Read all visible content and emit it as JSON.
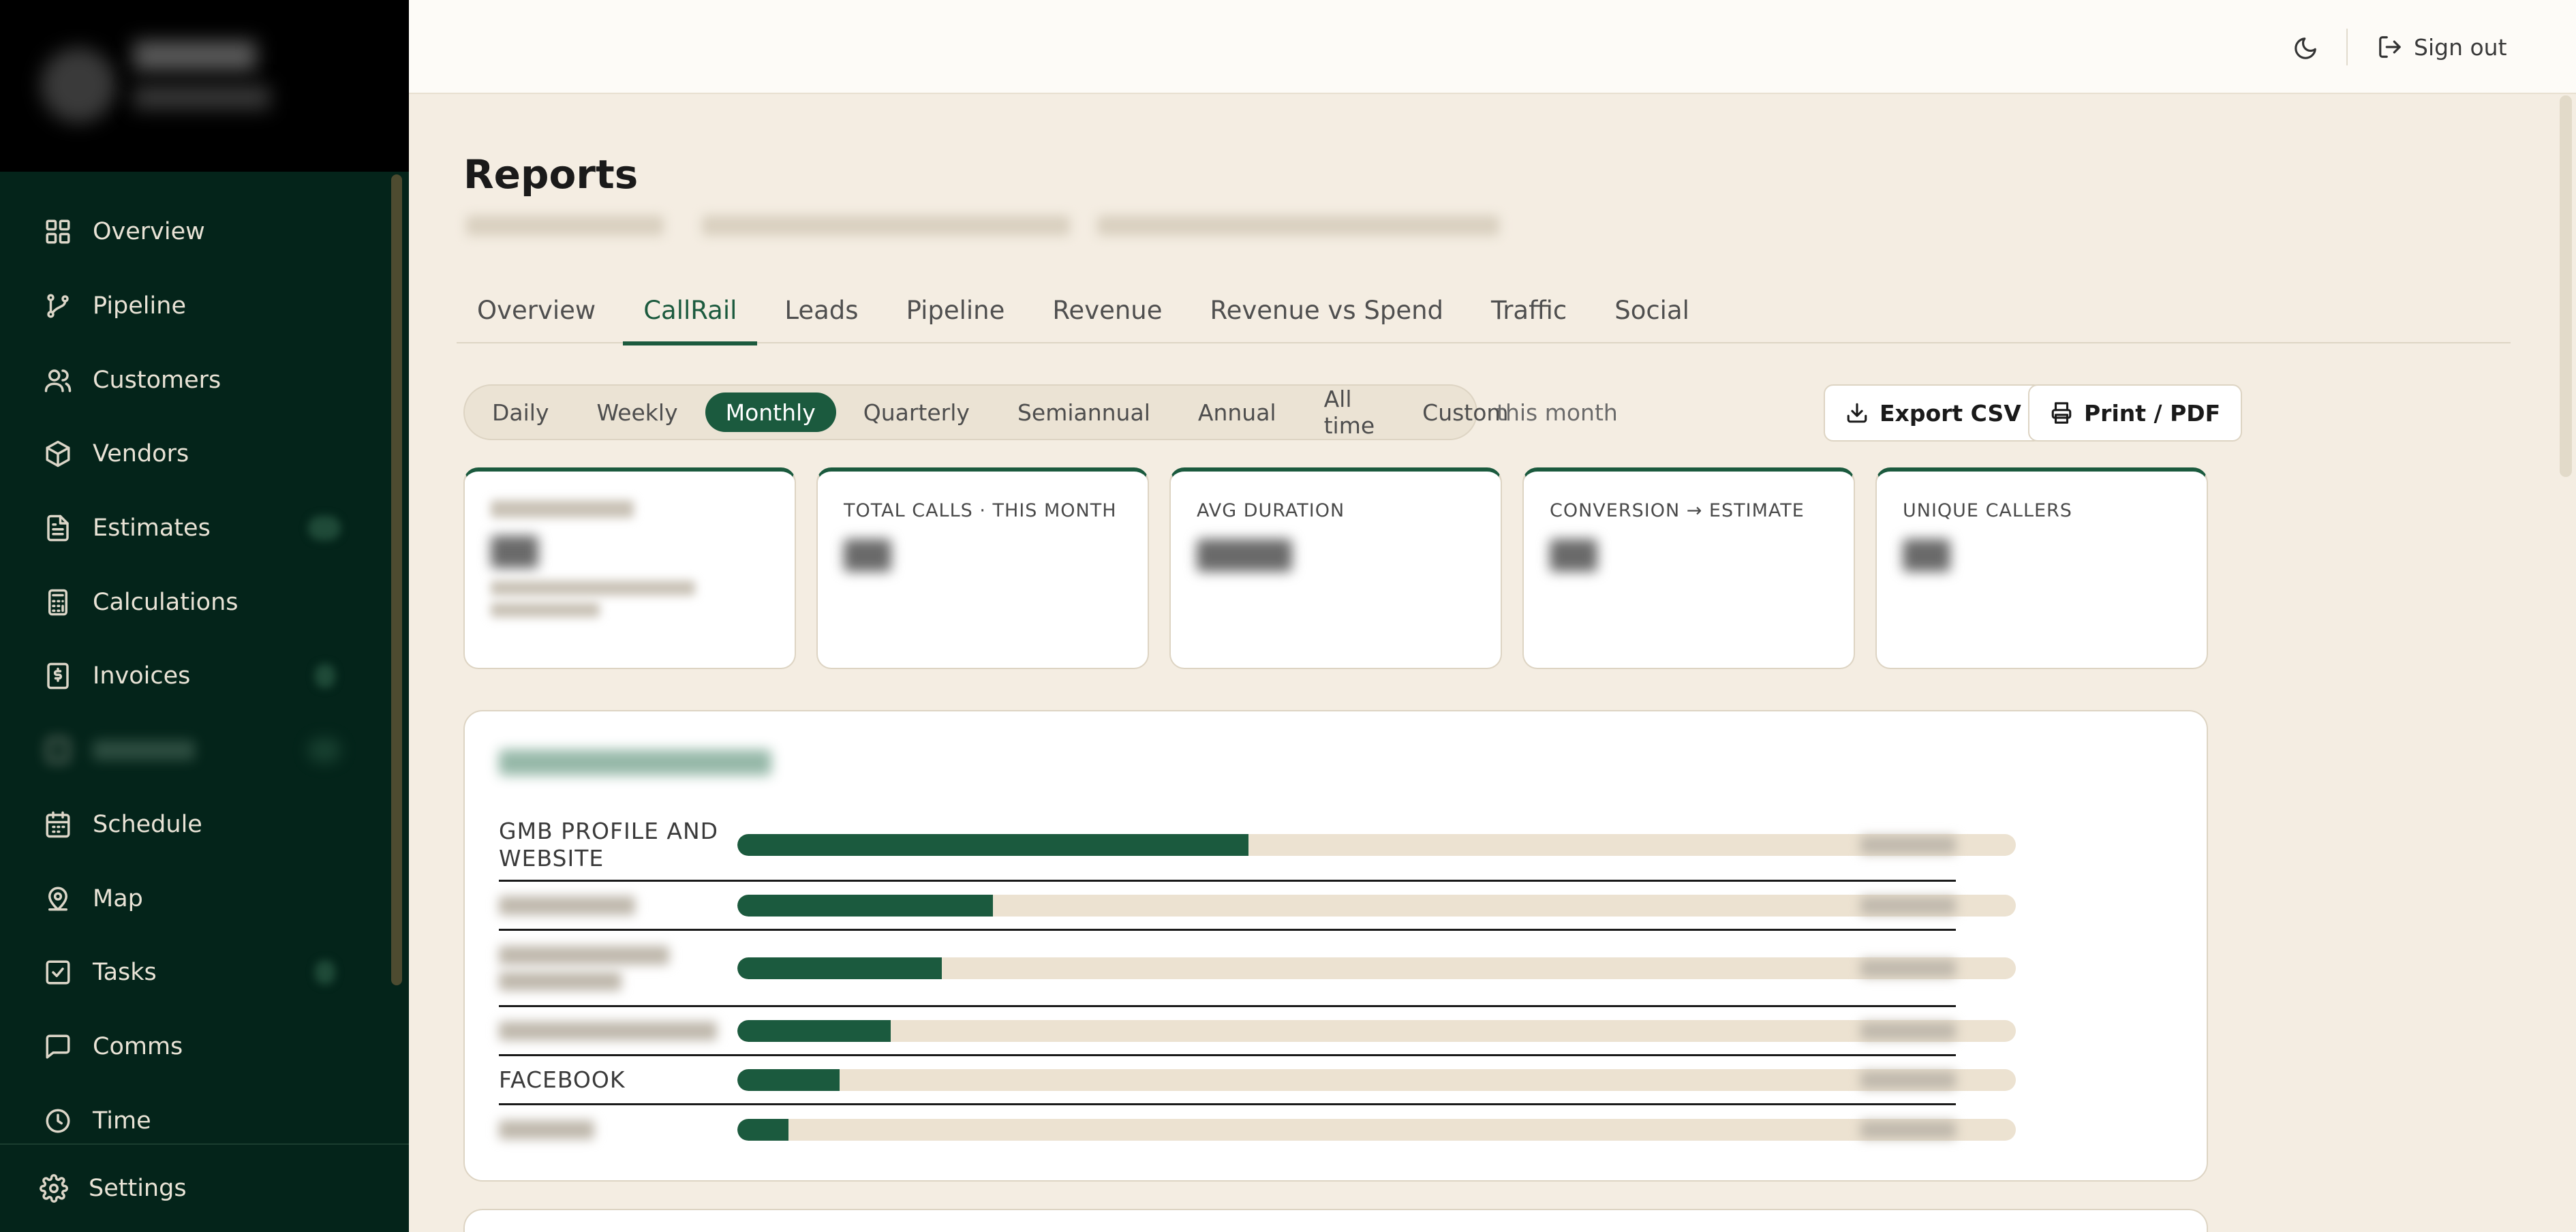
{
  "sidebar": {
    "items": [
      {
        "label": "Overview",
        "icon": "grid-icon"
      },
      {
        "label": "Pipeline",
        "icon": "branch-icon"
      },
      {
        "label": "Customers",
        "icon": "users-icon"
      },
      {
        "label": "Vendors",
        "icon": "package-icon"
      },
      {
        "label": "Estimates",
        "icon": "file-icon"
      },
      {
        "label": "Calculations",
        "icon": "calculator-icon"
      },
      {
        "label": "Invoices",
        "icon": "receipt-icon"
      },
      {
        "label": "Schedule",
        "icon": "calendar-icon"
      },
      {
        "label": "Map",
        "icon": "map-pin-icon"
      },
      {
        "label": "Tasks",
        "icon": "checkbox-icon"
      },
      {
        "label": "Comms",
        "icon": "message-icon"
      },
      {
        "label": "Time",
        "icon": "clock-icon"
      }
    ],
    "settings_label": "Settings"
  },
  "topbar": {
    "signout_label": "Sign out"
  },
  "page": {
    "title": "Reports"
  },
  "tabs": [
    "Overview",
    "CallRail",
    "Leads",
    "Pipeline",
    "Revenue",
    "Revenue vs Spend",
    "Traffic",
    "Social"
  ],
  "active_tab": "CallRail",
  "period": {
    "options": [
      "Daily",
      "Weekly",
      "Monthly",
      "Quarterly",
      "Semiannual",
      "Annual",
      "All time",
      "Custom"
    ],
    "selected": "Monthly",
    "note": "this month"
  },
  "actions": {
    "export_label": "Export CSV",
    "print_label": "Print / PDF"
  },
  "kpis": [
    {
      "label": ""
    },
    {
      "label": "TOTAL CALLS · THIS MONTH"
    },
    {
      "label": "AVG DURATION"
    },
    {
      "label": "CONVERSION → ESTIMATE"
    },
    {
      "label": "UNIQUE CALLERS"
    }
  ],
  "sources": [
    {
      "label": "GMB PROFILE AND WEBSITE",
      "share": 0.4
    },
    {
      "label": "",
      "share": 0.2
    },
    {
      "label": "",
      "share": 0.16
    },
    {
      "label": "",
      "share": 0.12
    },
    {
      "label": "FACEBOOK",
      "share": 0.08
    },
    {
      "label": "",
      "share": 0.04
    }
  ],
  "colors": {
    "sidebar_bg": "#04241a",
    "accent": "#1b5a3e",
    "page_bg": "#f4ede2",
    "track": "#ece2d1"
  }
}
